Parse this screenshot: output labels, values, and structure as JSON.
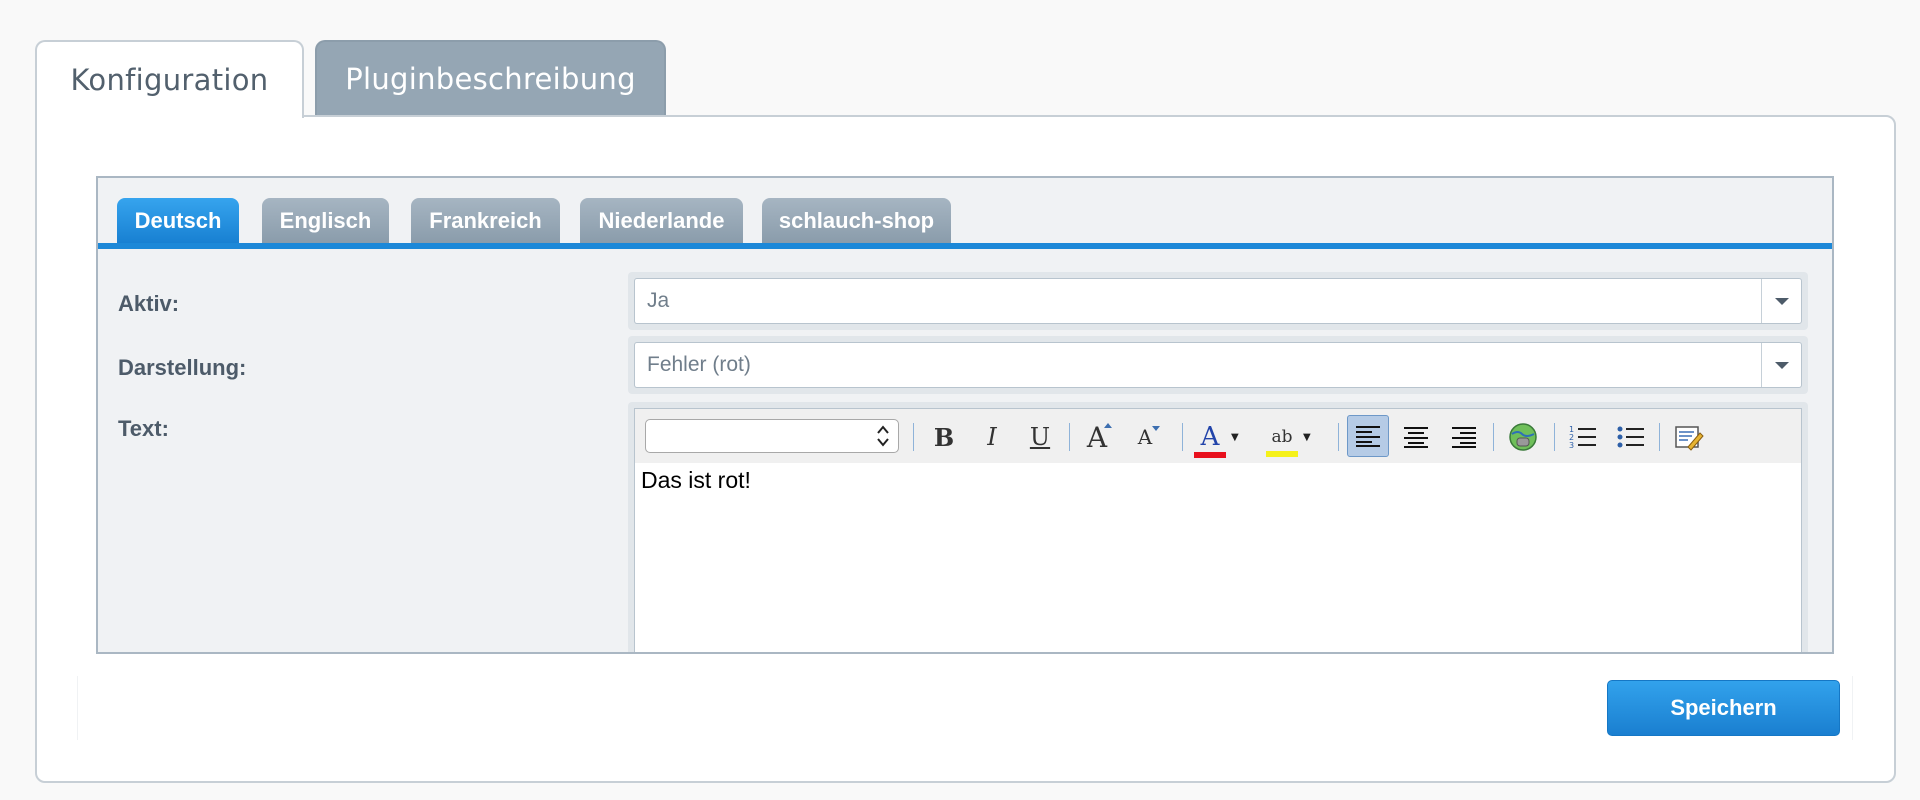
{
  "outer_tabs": [
    {
      "label": "Konfiguration",
      "active": true
    },
    {
      "label": "Pluginbeschreibung",
      "active": false
    }
  ],
  "language_tabs": [
    {
      "label": "Deutsch",
      "active": true
    },
    {
      "label": "Englisch",
      "active": false
    },
    {
      "label": "Frankreich",
      "active": false
    },
    {
      "label": "Niederlande",
      "active": false
    },
    {
      "label": "schlauch-shop",
      "active": false
    }
  ],
  "form": {
    "aktiv": {
      "label": "Aktiv:",
      "value": "Ja"
    },
    "darstellung": {
      "label": "Darstellung:",
      "value": "Fehler (rot)"
    },
    "text": {
      "label": "Text:",
      "content": "Das ist rot!",
      "font_value": ""
    }
  },
  "toolbar": {
    "bold": "B",
    "italic": "I",
    "underline": "U",
    "grow": "A",
    "shrink": "A",
    "fontcolor": "A",
    "highlight": "ab"
  },
  "colors": {
    "accent": "#1c88d8",
    "tab_inactive": "#95a6b4",
    "font_color_bar": "#e8101d",
    "highlight_bar": "#f5f11a"
  },
  "actions": {
    "save_label": "Speichern"
  }
}
